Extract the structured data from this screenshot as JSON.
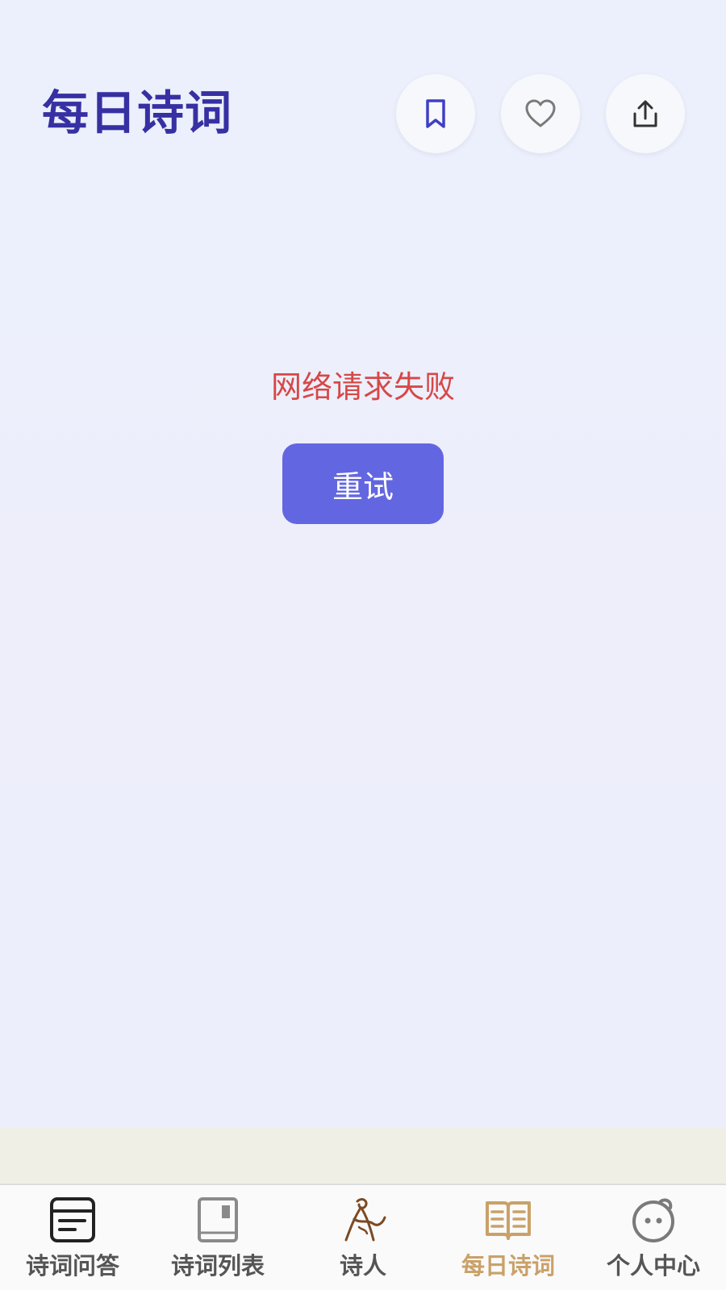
{
  "header": {
    "title": "每日诗词",
    "icons": [
      "bookmark-icon",
      "heart-icon",
      "share-icon"
    ]
  },
  "status": {
    "error_message": "网络请求失败",
    "retry_label": "重试"
  },
  "tabbar": {
    "items": [
      {
        "label": "诗词问答",
        "icon": "qa-icon",
        "active": false
      },
      {
        "label": "诗词列表",
        "icon": "book-icon",
        "active": false
      },
      {
        "label": "诗人",
        "icon": "poet-icon",
        "active": false
      },
      {
        "label": "每日诗词",
        "icon": "open-book-icon",
        "active": true
      },
      {
        "label": "个人中心",
        "icon": "profile-face-icon",
        "active": false
      }
    ]
  },
  "colors": {
    "title": "#3730a3",
    "error": "#d64848",
    "primary_button": "#6366e1",
    "tab_active": "#c9a169",
    "tab_inactive": "#555555"
  }
}
